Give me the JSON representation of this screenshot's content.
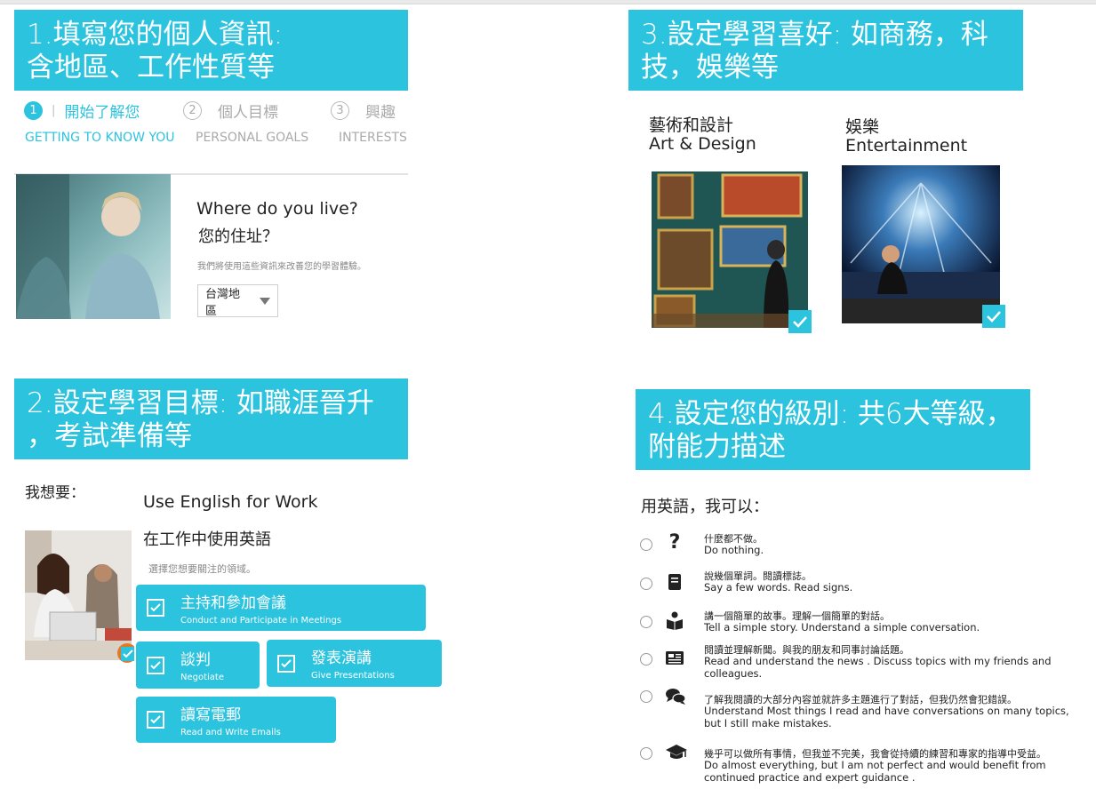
{
  "panel1": {
    "banner": "1.填寫您的個人資訊:\n含地區、工作性質等",
    "steps": [
      {
        "num": "1",
        "label": "開始了解您",
        "sub": "GETTING TO KNOW YOU"
      },
      {
        "num": "2",
        "label": "個人目標",
        "sub": "PERSONAL GOALS"
      },
      {
        "num": "3",
        "label": "興趣",
        "sub": "INTERESTS"
      }
    ],
    "question_en": "Where do you live?",
    "question_zh": "您的住址？",
    "note": "我們將使用這些資訊來改善您的學習體驗。",
    "region_select": "台灣地區"
  },
  "panel2": {
    "banner": "2.設定學習目標: 如職涯晉升\n，考試準備等",
    "want_label": "我想要：",
    "goal_en": "Use English for Work",
    "goal_zh": "在工作中使用英語",
    "choose_note": "選擇您想要關注的領域。",
    "tags": [
      {
        "zh": "主持和參加會議",
        "en": "Conduct and Participate in Meetings"
      },
      {
        "zh": "談判",
        "en": "Negotiate"
      },
      {
        "zh": "發表演講",
        "en": "Give Presentations"
      },
      {
        "zh": "讀寫電郵",
        "en": "Read and Write Emails"
      }
    ]
  },
  "panel3": {
    "banner": "3.設定學習喜好: 如商務，科\n技，娛樂等",
    "cards": [
      {
        "zh": "藝術和設計",
        "en": "Art & Design",
        "selected": true
      },
      {
        "zh": "娛樂",
        "en": "Entertainment",
        "selected": true
      }
    ]
  },
  "panel4": {
    "banner": "4.設定您的級別: 共6大等級，\n附能力描述",
    "intro": "用英語，我可以：",
    "levels": [
      {
        "icon": "question-icon",
        "zh": "什麼都不做。",
        "en": "Do nothing."
      },
      {
        "icon": "book-icon",
        "zh": "說幾個單詞。閱讀標誌。",
        "en": "Say a few words. Read signs."
      },
      {
        "icon": "reader-icon",
        "zh": "講一個簡單的故事。理解一個簡單的對話。",
        "en": "Tell a simple story. Understand a simple conversation."
      },
      {
        "icon": "newspaper-icon",
        "zh": "閱讀並理解新聞。與我的朋友和同事討論話題。",
        "en": "Read and understand the news . Discuss topics with my friends and colleagues."
      },
      {
        "icon": "chat-icon",
        "zh": "了解我閱讀的大部分內容並就許多主題進行了對話，但我仍然會犯錯誤。",
        "en": "Understand Most things I read and have conversations on many topics, but I still make mistakes."
      },
      {
        "icon": "graduation-cap-icon",
        "zh": "幾乎可以做所有事情，但我並不完美，我會從持續的練習和專家的指導中受益。",
        "en": "Do almost everything, but I am not perfect and would benefit from continued practice and expert guidance ."
      }
    ]
  },
  "colors": {
    "accent": "#2cc3de"
  }
}
